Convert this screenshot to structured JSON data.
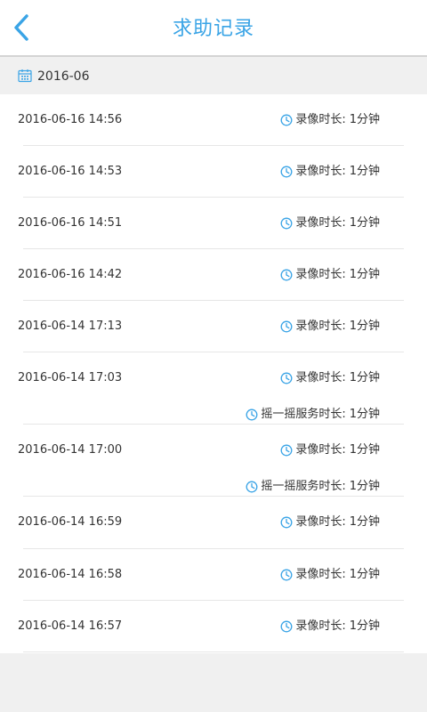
{
  "header": {
    "title": "求助记录",
    "back_icon": "chevron-left-icon"
  },
  "month": {
    "label": "2016-06",
    "icon": "calendar-icon"
  },
  "colors": {
    "accent": "#3aa4e6",
    "text": "#333333",
    "bg": "#f0f0f0",
    "divider": "#e6e6e6"
  },
  "records": [
    {
      "time": "2016-06-16 14:56",
      "details": [
        {
          "label": "录像时长:",
          "value": "1分钟"
        }
      ]
    },
    {
      "time": "2016-06-16 14:53",
      "details": [
        {
          "label": "录像时长:",
          "value": "1分钟"
        }
      ]
    },
    {
      "time": "2016-06-16 14:51",
      "details": [
        {
          "label": "录像时长:",
          "value": "1分钟"
        }
      ]
    },
    {
      "time": "2016-06-16 14:42",
      "details": [
        {
          "label": "录像时长:",
          "value": "1分钟"
        }
      ]
    },
    {
      "time": "2016-06-14 17:13",
      "details": [
        {
          "label": "录像时长:",
          "value": "1分钟"
        }
      ]
    },
    {
      "time": "2016-06-14 17:03",
      "details": [
        {
          "label": "录像时长:",
          "value": "1分钟"
        },
        {
          "label": "摇一摇服务时长:",
          "value": "1分钟"
        }
      ]
    },
    {
      "time": "2016-06-14 17:00",
      "details": [
        {
          "label": "录像时长:",
          "value": "1分钟"
        },
        {
          "label": "摇一摇服务时长:",
          "value": "1分钟"
        }
      ]
    },
    {
      "time": "2016-06-14 16:59",
      "details": [
        {
          "label": "录像时长:",
          "value": "1分钟"
        }
      ]
    },
    {
      "time": "2016-06-14 16:58",
      "details": [
        {
          "label": "录像时长:",
          "value": "1分钟"
        }
      ]
    },
    {
      "time": "2016-06-14 16:57",
      "details": [
        {
          "label": "录像时长:",
          "value": "1分钟"
        }
      ]
    }
  ]
}
